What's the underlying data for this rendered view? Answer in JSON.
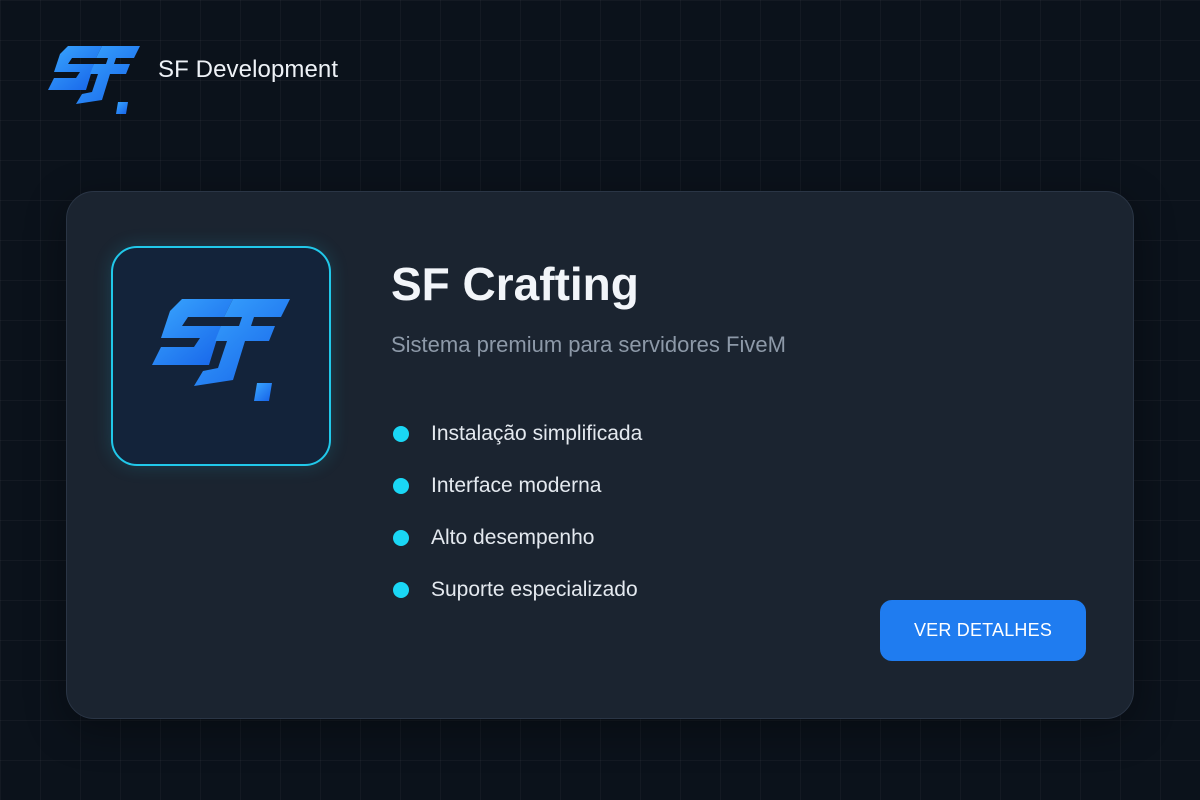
{
  "header": {
    "logo_icon": "sf-logo-icon",
    "brand_name": "SF Development"
  },
  "card": {
    "icon": "sf-logo-icon",
    "title": "SF Crafting",
    "subtitle": "Sistema premium para servidores FiveM",
    "features": [
      "Instalação simplificada",
      "Interface moderna",
      "Alto desempenho",
      "Suporte especializado"
    ],
    "button_label": "VER DETALHES"
  },
  "colors": {
    "background": "#0b121b",
    "card": "#1b2430",
    "accent_cyan": "#1ad7f5",
    "button_blue": "#1f7cf0",
    "logo_blue": "#1e88ff"
  }
}
